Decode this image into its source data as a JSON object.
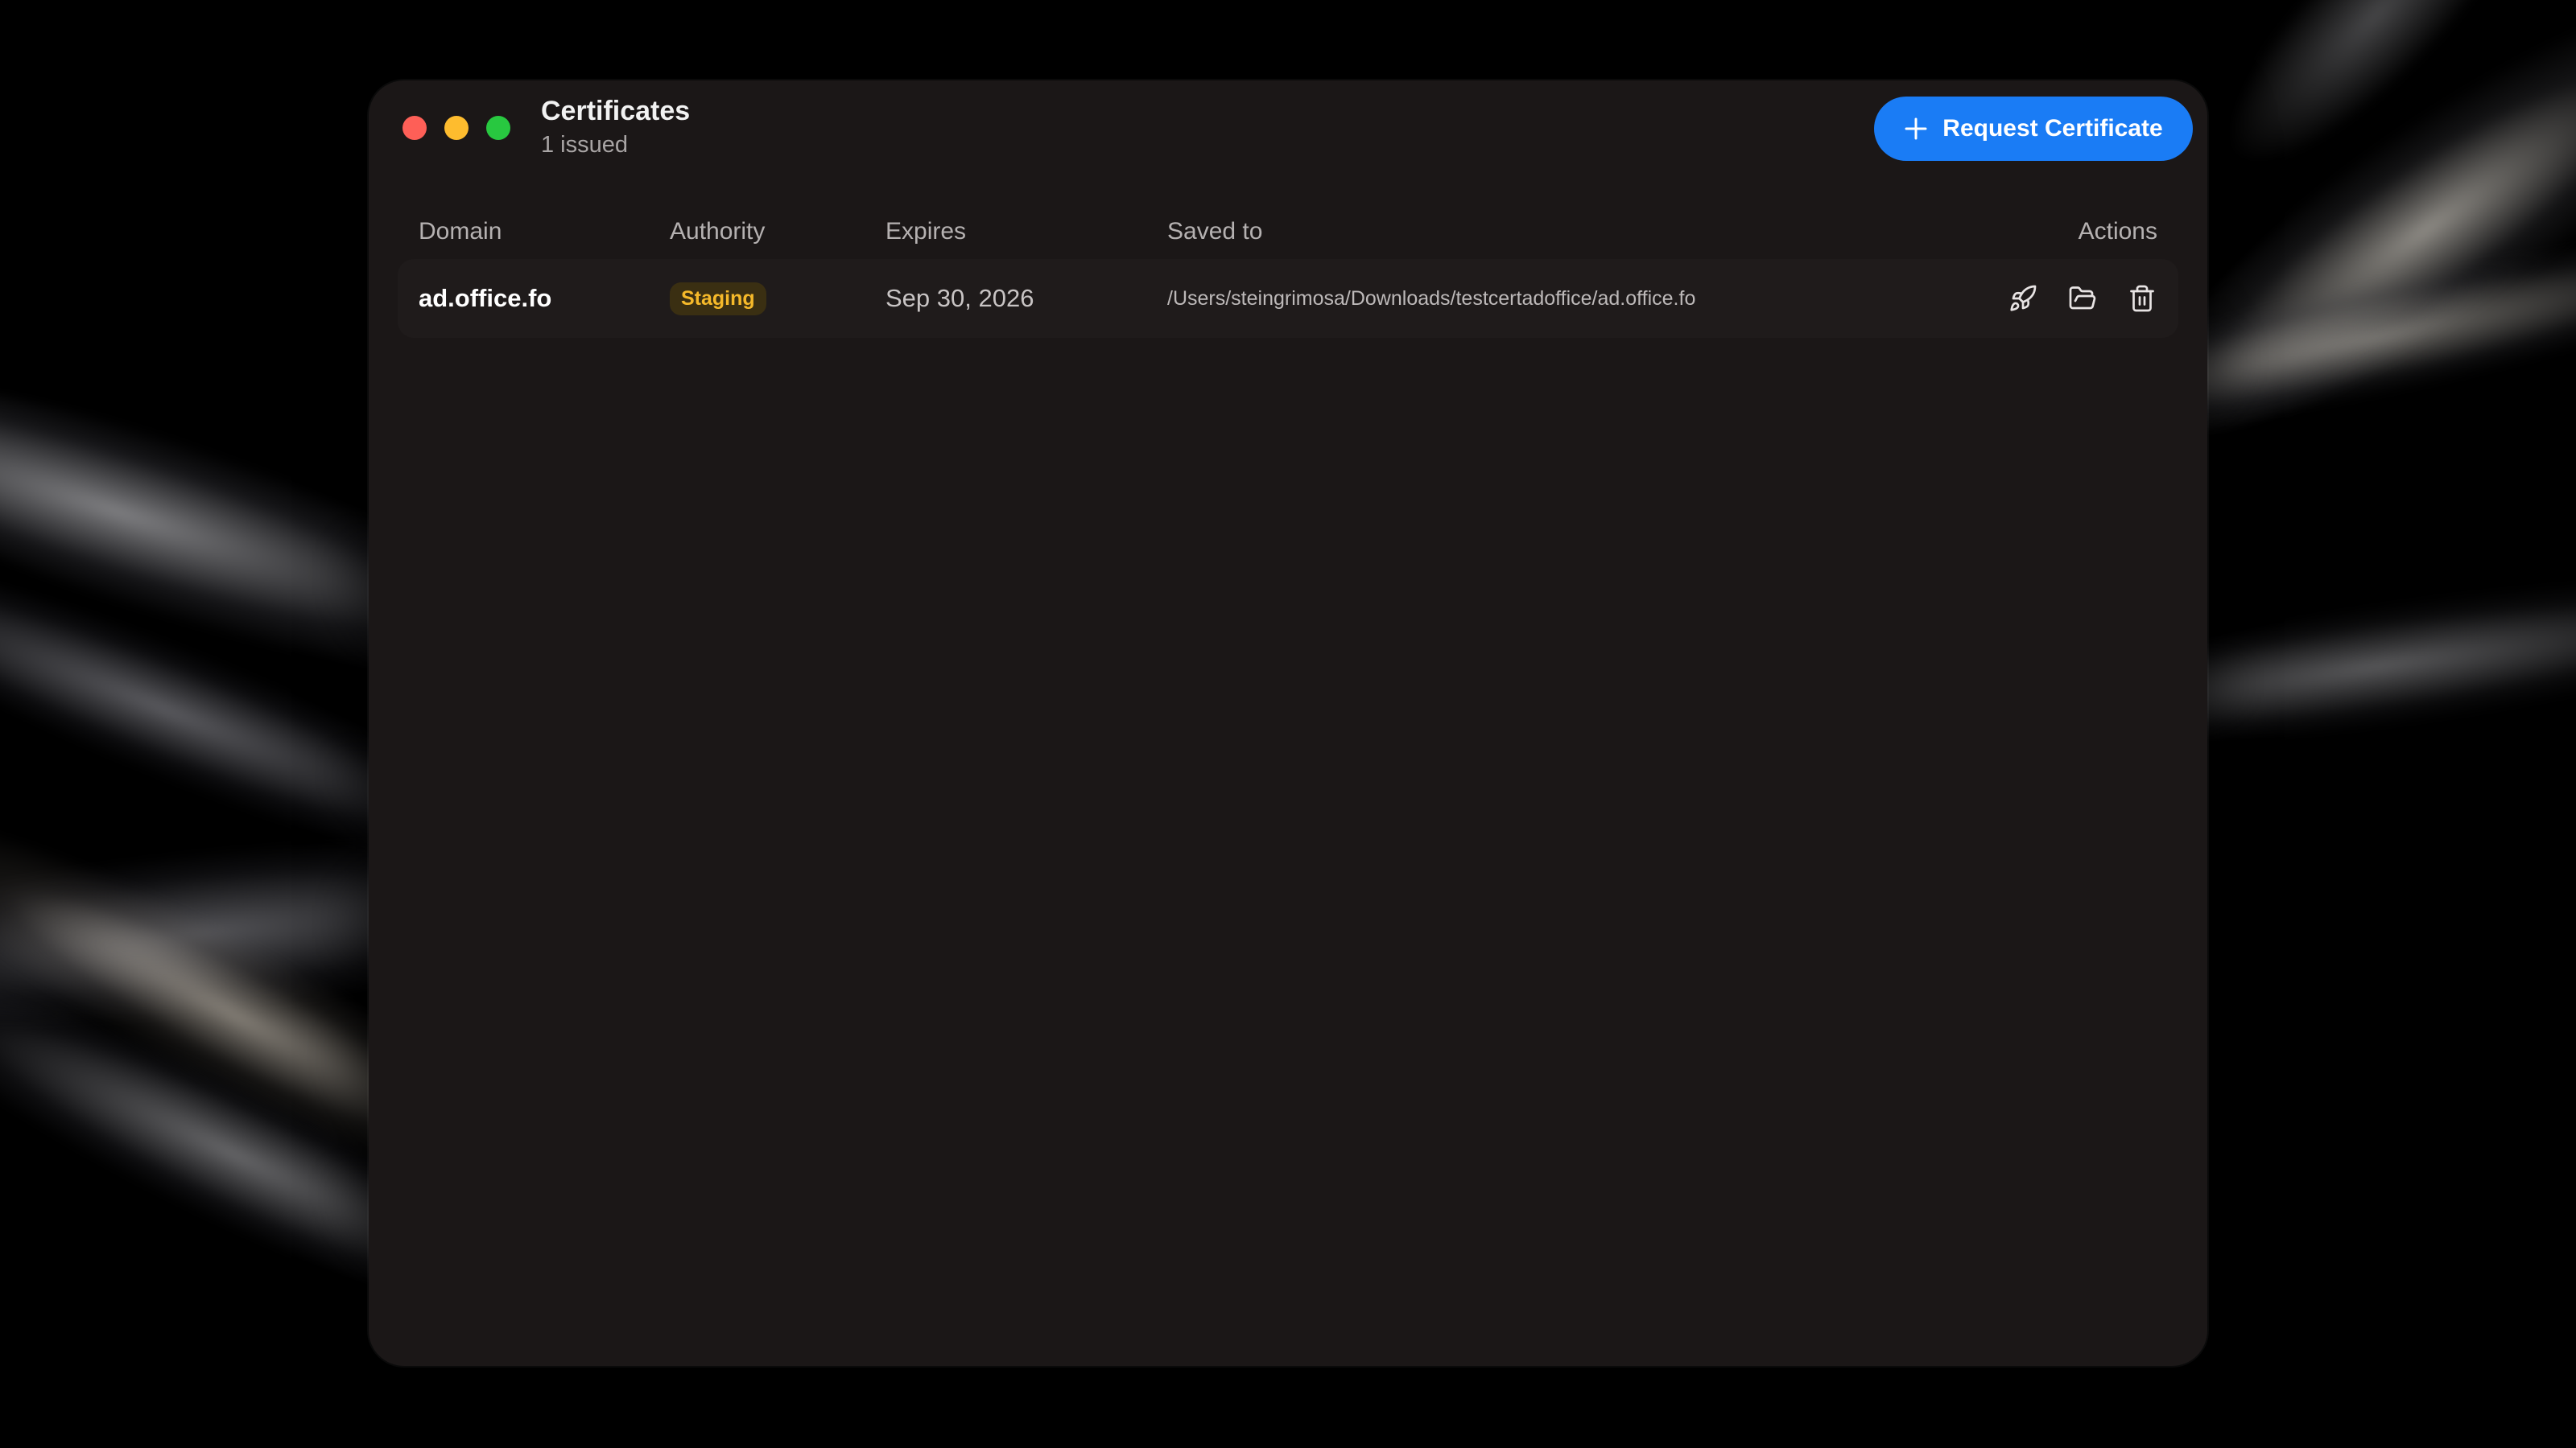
{
  "window": {
    "title": "Certificates",
    "subtitle": "1 issued"
  },
  "toolbar": {
    "request_label": "Request Certificate",
    "request_icon": "plus-icon",
    "accent_color": "#1a7cf5"
  },
  "table": {
    "headers": {
      "domain": "Domain",
      "authority": "Authority",
      "expires": "Expires",
      "saved_to": "Saved to",
      "actions": "Actions"
    },
    "rows": [
      {
        "domain": "ad.office.fo",
        "authority": "Staging",
        "expires": "Sep 30, 2026",
        "saved_to": "/Users/steingrimosa/Downloads/testcertadoffice/ad.office.fo",
        "actions": [
          "rocket-icon",
          "folder-open-icon",
          "trash-icon"
        ]
      }
    ]
  },
  "colors": {
    "badge_text": "#f5b92a",
    "badge_bg": "#3a2f12",
    "window_bg": "#1b1717",
    "close": "#fe5f57",
    "minimize": "#febc2e",
    "zoom": "#28c840"
  }
}
